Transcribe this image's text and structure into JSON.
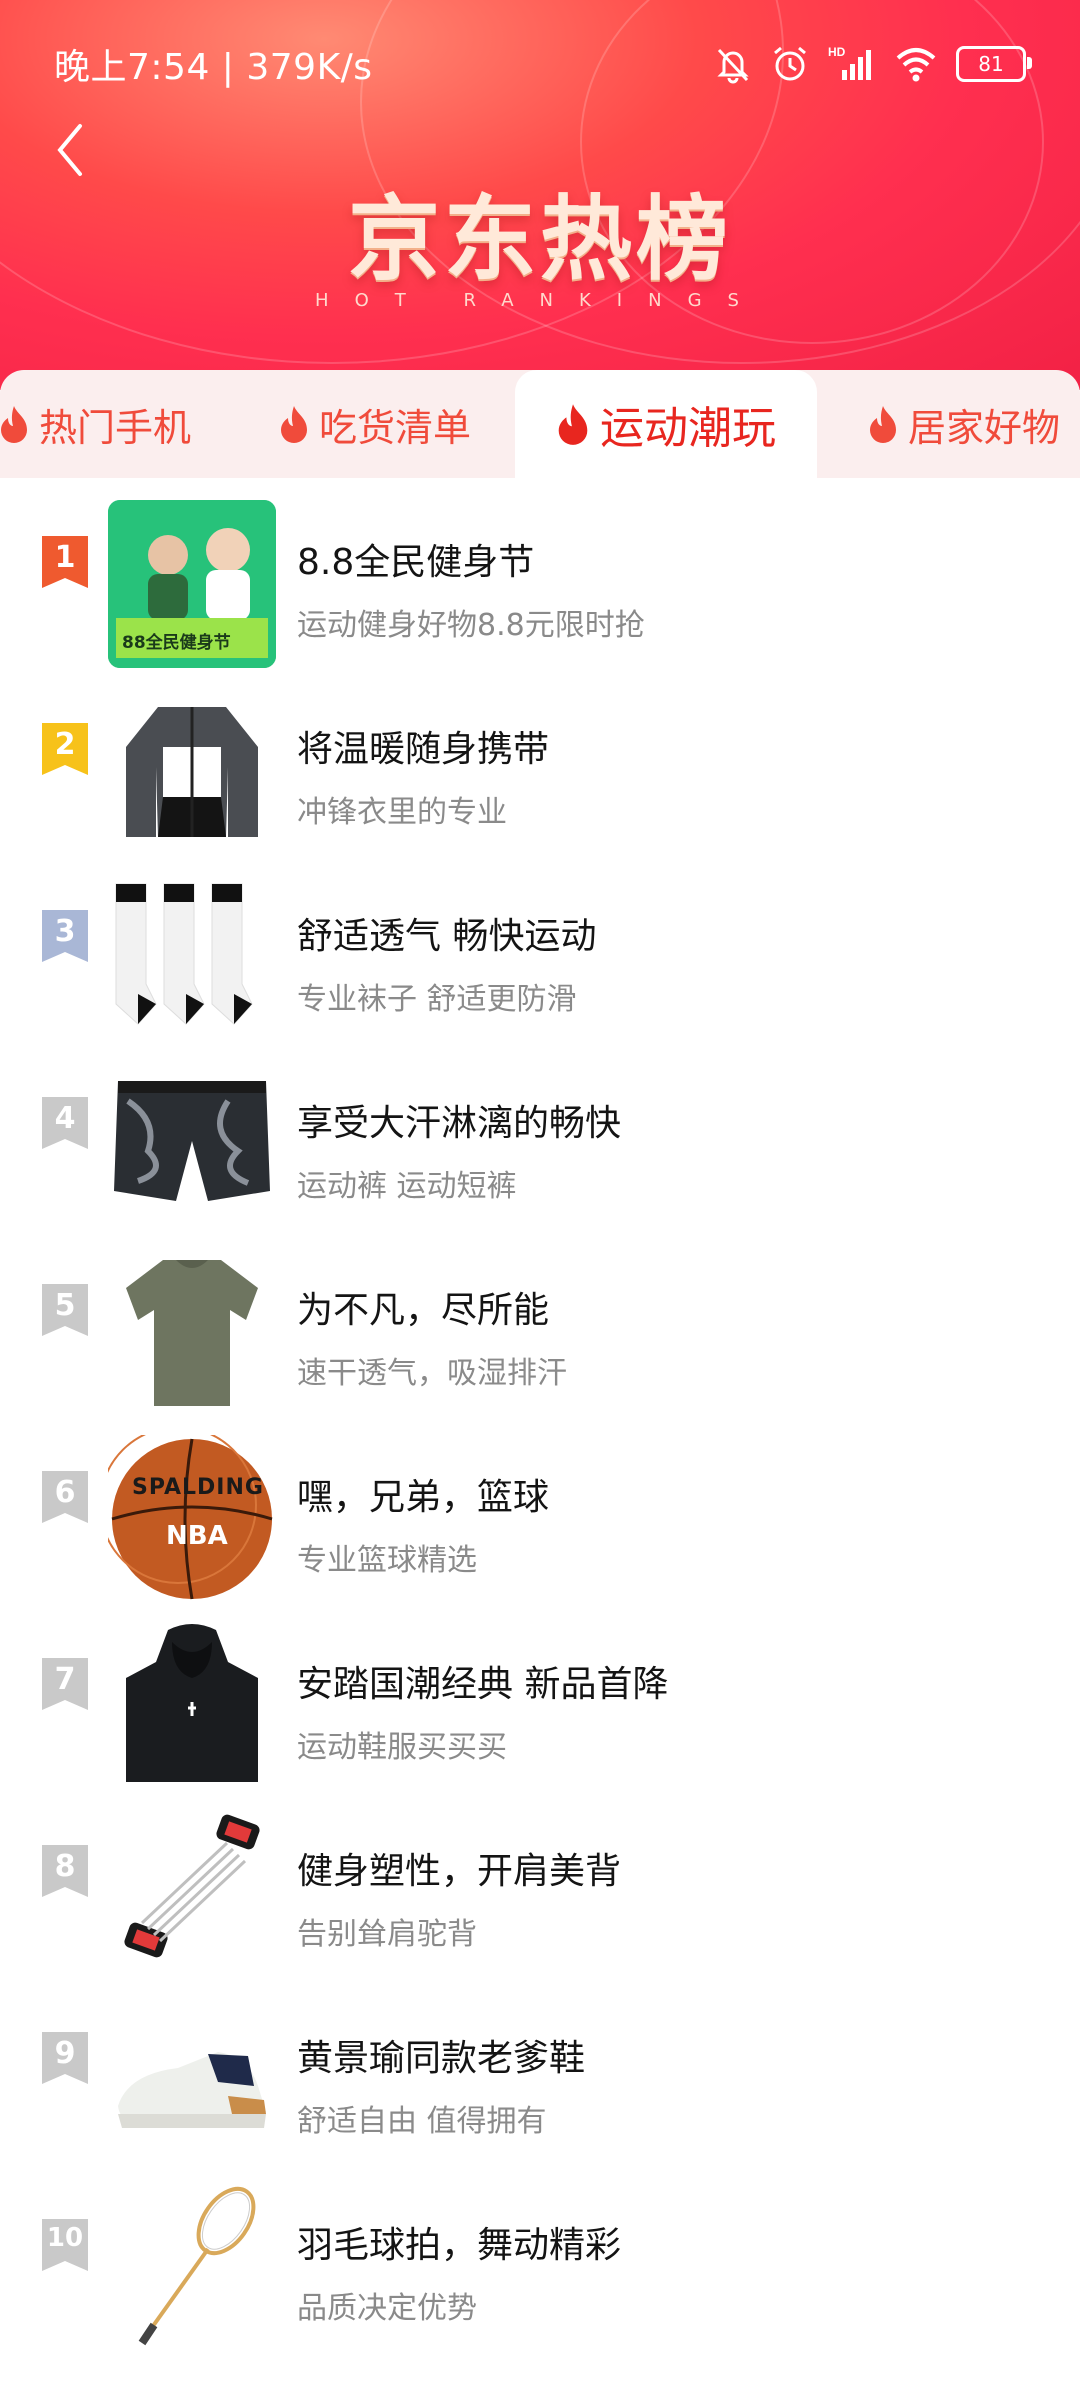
{
  "status_bar": {
    "time_speed": "晚上7:54 | 379K/s",
    "battery": "81"
  },
  "header": {
    "title": "京东热榜",
    "subtitle": "HOT RANKINGS"
  },
  "tabs": [
    {
      "label": "热门手机"
    },
    {
      "label": "吃货清单"
    },
    {
      "label": "运动潮玩",
      "active": true
    },
    {
      "label": "居家好物"
    }
  ],
  "items": [
    {
      "rank": "1",
      "title": "8.8全民健身节",
      "subtitle": "运动健身好物8.8元限时抢"
    },
    {
      "rank": "2",
      "title": "将温暖随身携带",
      "subtitle": "冲锋衣里的专业"
    },
    {
      "rank": "3",
      "title": "舒适透气 畅快运动",
      "subtitle": "专业袜子 舒适更防滑"
    },
    {
      "rank": "4",
      "title": "享受大汗淋漓的畅快",
      "subtitle": "运动裤 运动短裤"
    },
    {
      "rank": "5",
      "title": "为不凡，尽所能",
      "subtitle": "速干透气，吸湿排汗"
    },
    {
      "rank": "6",
      "title": "嘿，兄弟，篮球",
      "subtitle": "专业篮球精选"
    },
    {
      "rank": "7",
      "title": "安踏国潮经典 新品首降",
      "subtitle": "运动鞋服买买买"
    },
    {
      "rank": "8",
      "title": "健身塑性，开肩美背",
      "subtitle": "告别耸肩驼背"
    },
    {
      "rank": "9",
      "title": "黄景瑜同款老爹鞋",
      "subtitle": "舒适自由 值得拥有"
    },
    {
      "rank": "10",
      "title": "羽毛球拍，舞动精彩",
      "subtitle": "品质决定优势"
    }
  ],
  "thumb_text": {
    "promo": "88全民健身节",
    "basketball_brand": "SPALDING",
    "basketball_league": "NBA"
  },
  "colors": {
    "rank1": "#ef5a2f",
    "rank2": "#f7c21a",
    "rank3": "#a9b7d6",
    "rank_other": "#c9c9c9",
    "accent": "#e8261f"
  }
}
